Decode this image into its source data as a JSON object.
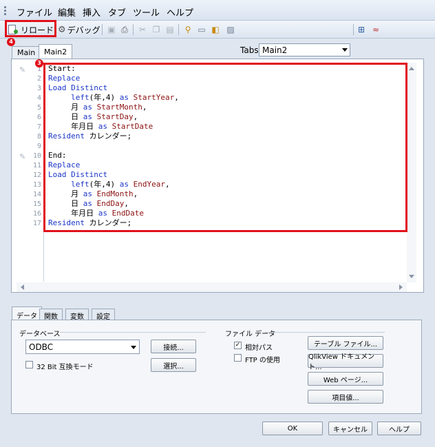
{
  "menu": {
    "items": [
      "ファイル",
      "編集",
      "挿入",
      "タブ",
      "ツール",
      "ヘルプ"
    ]
  },
  "toolbar": {
    "reload_label": "リロード",
    "debug_label": "デバッグ",
    "tabs_label": "Tabs",
    "tabs_selected": "Main2"
  },
  "annotations": {
    "toolbar_badge": "4",
    "editor_badge": "3"
  },
  "accent_color": "#e0101a",
  "doc_tabs": [
    "Main",
    "Main2"
  ],
  "editor": {
    "line_numbers": [
      "1",
      "2",
      "3",
      "4",
      "5",
      "6",
      "7",
      "8",
      "9",
      "10",
      "11",
      "12",
      "13",
      "14",
      "15",
      "16",
      "17"
    ],
    "lines": [
      [
        {
          "t": "Start:",
          "c": "pl"
        }
      ],
      [
        {
          "t": "Replace",
          "c": "kw"
        }
      ],
      [
        {
          "t": "Load Distinct",
          "c": "kw"
        }
      ],
      [
        {
          "t": "     ",
          "c": "pl"
        },
        {
          "t": "left",
          "c": "fn"
        },
        {
          "t": "(年,4) ",
          "c": "pl"
        },
        {
          "t": "as",
          "c": "kw"
        },
        {
          "t": " StartYear",
          "c": "fld"
        },
        {
          "t": ",",
          "c": "pl"
        }
      ],
      [
        {
          "t": "     月 ",
          "c": "pl"
        },
        {
          "t": "as",
          "c": "kw"
        },
        {
          "t": " StartMonth",
          "c": "fld"
        },
        {
          "t": ",",
          "c": "pl"
        }
      ],
      [
        {
          "t": "     日 ",
          "c": "pl"
        },
        {
          "t": "as",
          "c": "kw"
        },
        {
          "t": " StartDay",
          "c": "fld"
        },
        {
          "t": ",",
          "c": "pl"
        }
      ],
      [
        {
          "t": "     年月日 ",
          "c": "pl"
        },
        {
          "t": "as",
          "c": "kw"
        },
        {
          "t": " StartDate",
          "c": "fld"
        }
      ],
      [
        {
          "t": "Resident",
          "c": "kw"
        },
        {
          "t": " カレンダー;",
          "c": "pl"
        }
      ],
      [
        {
          "t": "",
          "c": "pl"
        }
      ],
      [
        {
          "t": "End:",
          "c": "pl"
        }
      ],
      [
        {
          "t": "Replace",
          "c": "kw"
        }
      ],
      [
        {
          "t": "Load Distinct",
          "c": "kw"
        }
      ],
      [
        {
          "t": "     ",
          "c": "pl"
        },
        {
          "t": "left",
          "c": "fn"
        },
        {
          "t": "(年,4) ",
          "c": "pl"
        },
        {
          "t": "as",
          "c": "kw"
        },
        {
          "t": " EndYear",
          "c": "fld"
        },
        {
          "t": ",",
          "c": "pl"
        }
      ],
      [
        {
          "t": "     月 ",
          "c": "pl"
        },
        {
          "t": "as",
          "c": "kw"
        },
        {
          "t": " EndMonth",
          "c": "fld"
        },
        {
          "t": ",",
          "c": "pl"
        }
      ],
      [
        {
          "t": "     日 ",
          "c": "pl"
        },
        {
          "t": "as",
          "c": "kw"
        },
        {
          "t": " EndDay",
          "c": "fld"
        },
        {
          "t": ",",
          "c": "pl"
        }
      ],
      [
        {
          "t": "     年月日 ",
          "c": "pl"
        },
        {
          "t": "as",
          "c": "kw"
        },
        {
          "t": " EndDate",
          "c": "fld"
        }
      ],
      [
        {
          "t": "Resident",
          "c": "kw"
        },
        {
          "t": " カレンダー;",
          "c": "pl"
        }
      ]
    ]
  },
  "panel": {
    "tabs": [
      "データ",
      "関数",
      "変数",
      "設定"
    ],
    "database_group": "データベース",
    "database_value": "ODBC",
    "connect_button": "接続...",
    "select_button": "選択...",
    "compat_label": "32 Bit 互換モード",
    "compat_checked": false,
    "file_data_group": "ファイル データ",
    "relative_path_label": "相対パス",
    "relative_path_checked": true,
    "ftp_label": "FTP の使用",
    "ftp_checked": false,
    "table_file_button": "テーブル ファイル...",
    "qlikview_doc_button": "QlikView ドキュメント...",
    "web_page_button": "Web ページ...",
    "field_value_button": "項目値..."
  },
  "footer": {
    "ok": "OK",
    "cancel": "キャンセル",
    "help": "ヘルプ"
  }
}
